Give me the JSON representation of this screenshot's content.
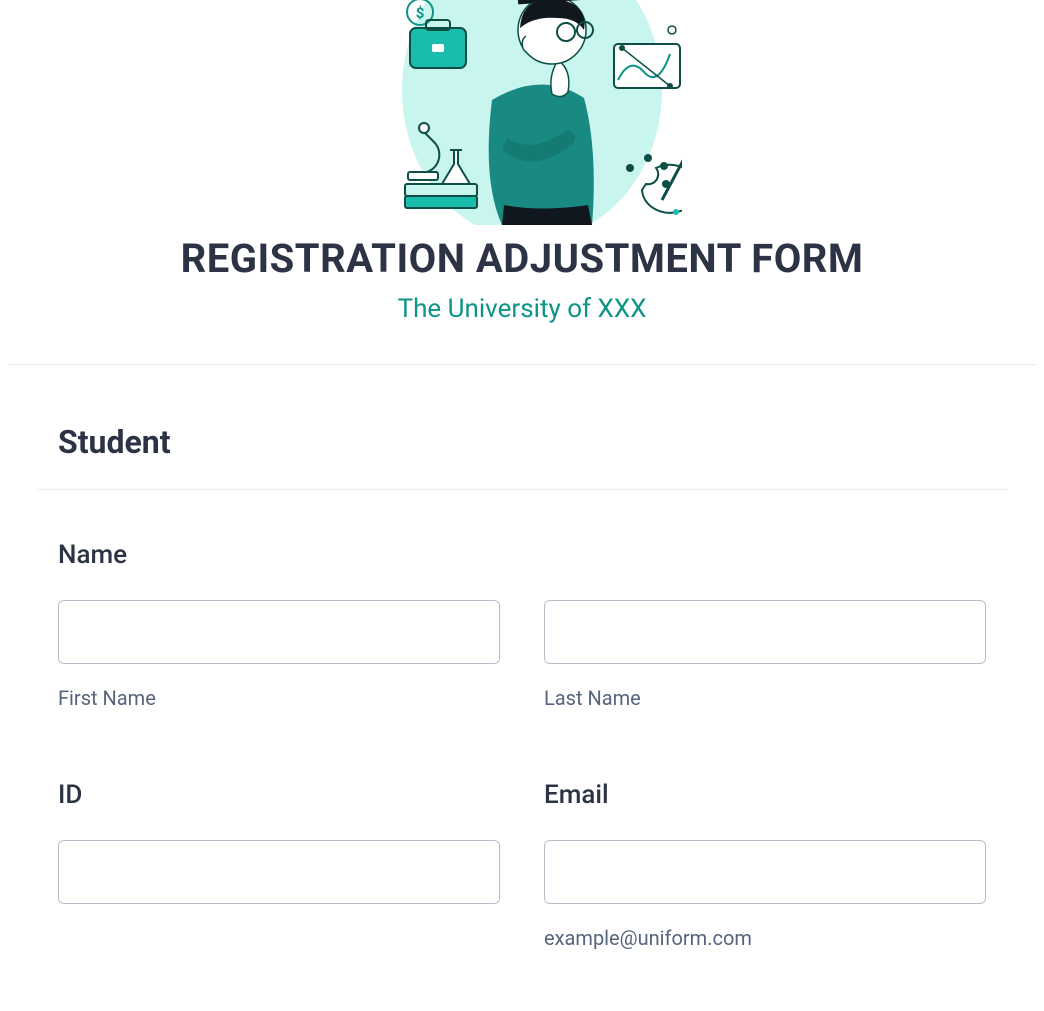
{
  "header": {
    "title": "REGISTRATION ADJUSTMENT FORM",
    "subtitle": "The University of XXX"
  },
  "section": {
    "heading": "Student"
  },
  "fields": {
    "name": {
      "label": "Name",
      "first_sub": "First Name",
      "last_sub": "Last Name",
      "first_value": "",
      "last_value": ""
    },
    "id": {
      "label": "ID",
      "value": ""
    },
    "email": {
      "label": "Email",
      "helper": "example@uniform.com",
      "value": ""
    }
  }
}
